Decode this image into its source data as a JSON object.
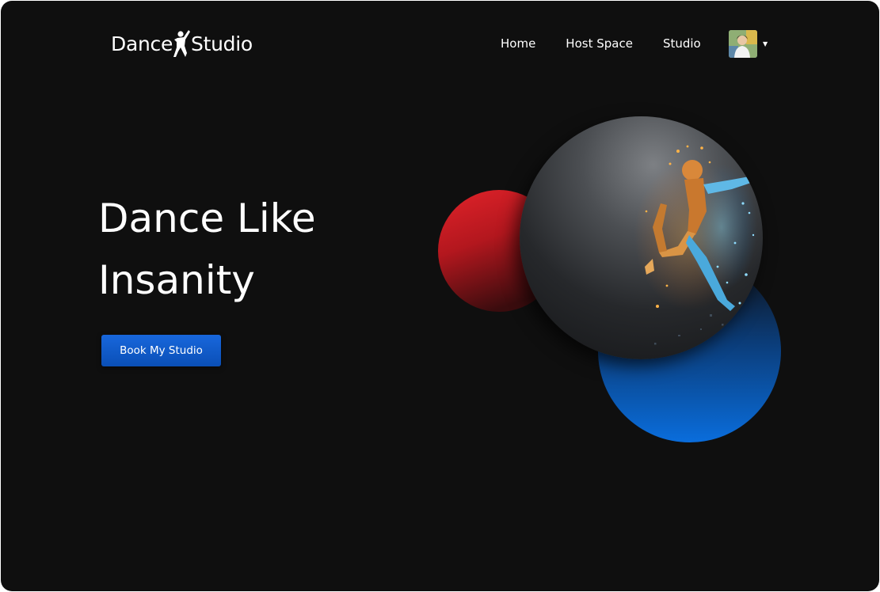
{
  "brand": {
    "name_part1": "Dance",
    "name_part2": "Studio",
    "logo_icon": "dancer-icon"
  },
  "nav": {
    "items": [
      {
        "label": "Home"
      },
      {
        "label": "Host Space"
      },
      {
        "label": "Studio"
      }
    ],
    "avatar_icon": "user-avatar",
    "dropdown_icon": "caret-down-icon",
    "dropdown_glyph": "▼"
  },
  "hero": {
    "title_line1": "Dance Like",
    "title_line2": "Insanity",
    "cta_label": "Book My Studio",
    "image_subject": "dancer-photo"
  },
  "colors": {
    "background": "#0f0f0f",
    "accent_blue": "#0a6ddc",
    "accent_red": "#e2232a",
    "text": "#ffffff"
  }
}
